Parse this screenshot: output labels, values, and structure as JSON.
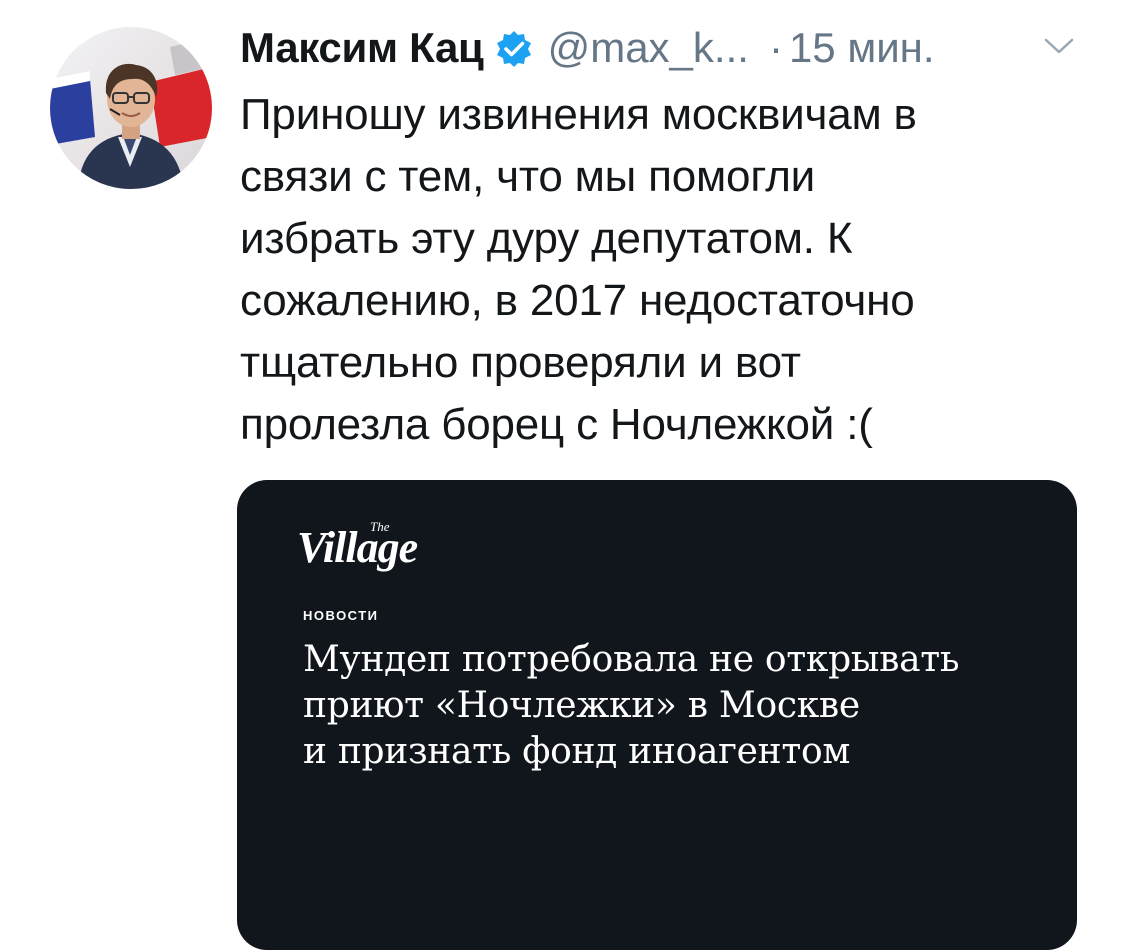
{
  "tweet": {
    "author": {
      "display_name": "Максим Кац",
      "verified": true,
      "verified_icon": "verified-badge-icon",
      "handle": "@max_k...",
      "avatar": "profile-photo"
    },
    "separator": "·",
    "time": "15 мин.",
    "menu_icon": "chevron-down-icon",
    "text_lines": [
      "Приношу извинения москвичам в",
      "связи с тем, что мы помогли",
      "избрать эту дуру депутатом. К",
      "сожалению, в 2017 недостаточно",
      "тщательно проверяли и вот",
      "пролезла борец с Ночлежкой :("
    ],
    "card": {
      "logo_text": "Village",
      "logo_the": "The",
      "category": "НОВОСТИ",
      "headline_lines": [
        "Мундеп потребовала не открывать",
        "приют «Ночлежки» в Москве",
        "и признать фонд иноагентом"
      ]
    }
  },
  "colors": {
    "text_primary": "#14171a",
    "text_secondary": "#657786",
    "verified_blue": "#1da1f2",
    "card_background": "#11151c",
    "card_text": "#ffffff"
  }
}
